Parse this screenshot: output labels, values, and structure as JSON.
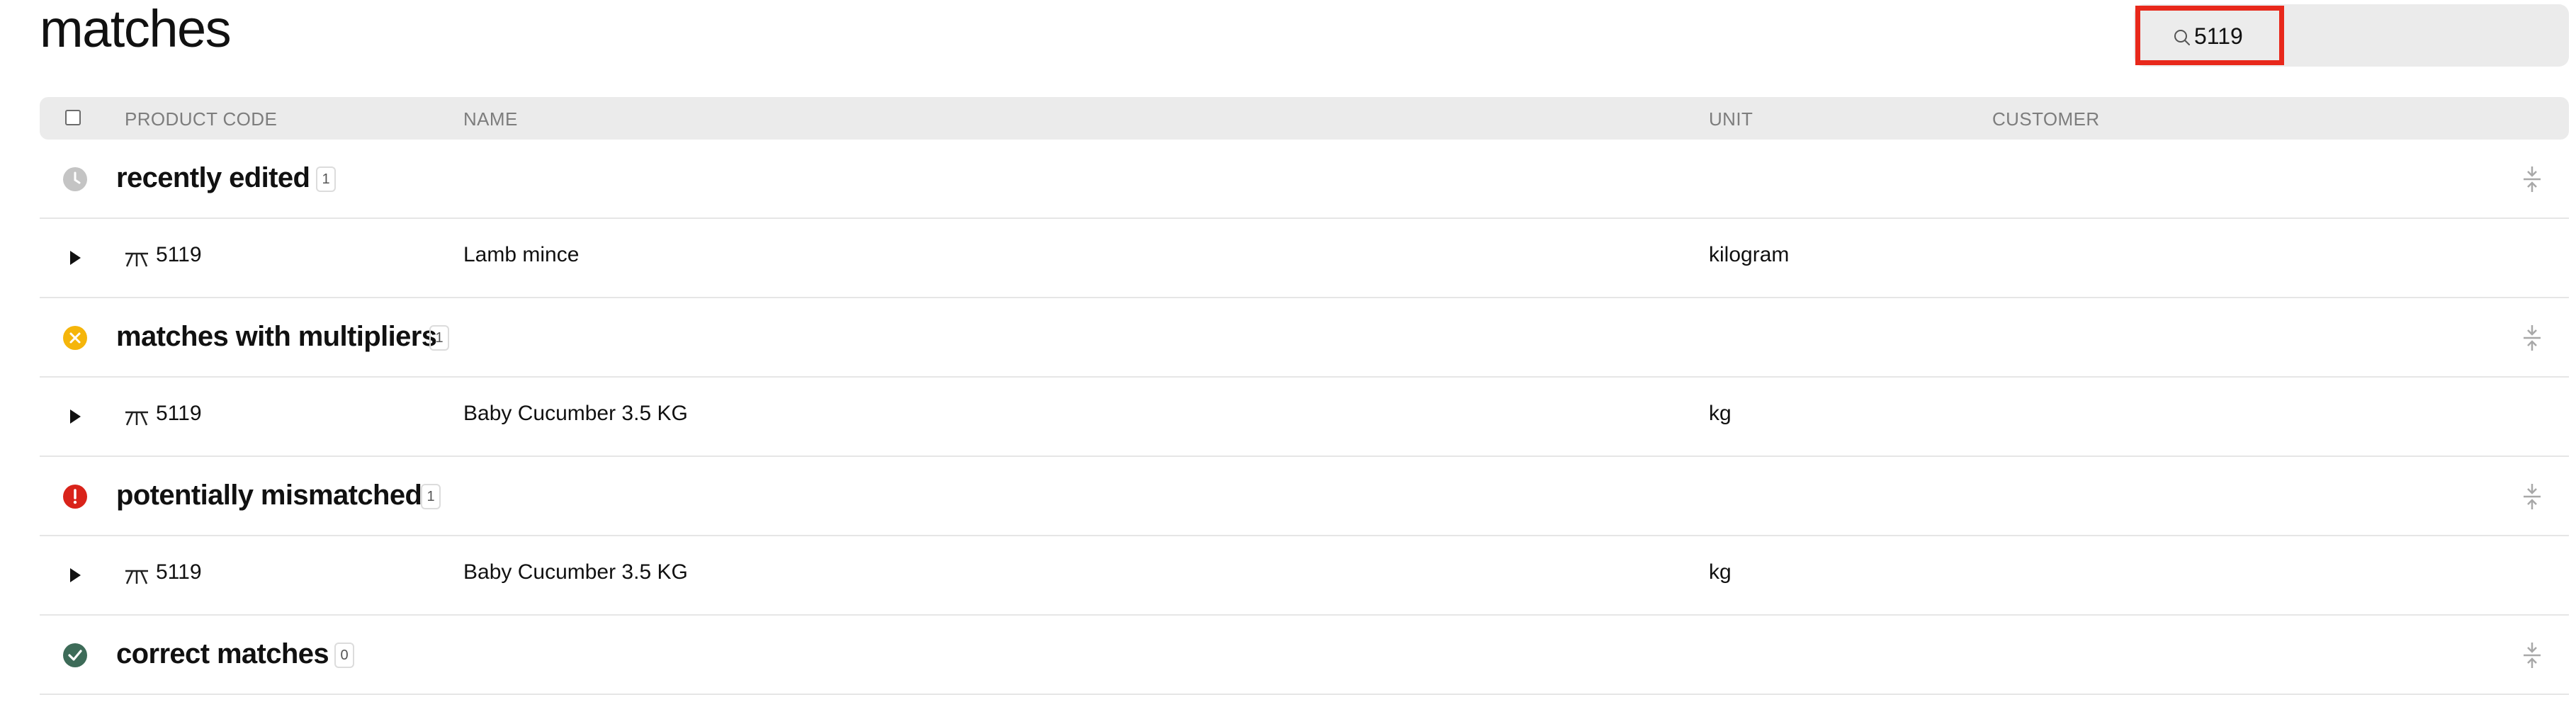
{
  "page": {
    "title": "matches"
  },
  "search": {
    "value": "5119",
    "placeholder": ""
  },
  "table": {
    "columns": {
      "product_code": "PRODUCT CODE",
      "name": "NAME",
      "unit": "UNIT",
      "customer": "CUSTOMER"
    }
  },
  "groups": [
    {
      "label": "recently edited",
      "count": "1",
      "icon": "clock-icon",
      "color": "#c4c4c4",
      "items": [
        {
          "code": "5119",
          "name": "Lamb mince",
          "unit": "kilogram",
          "customer": ""
        }
      ]
    },
    {
      "label": "matches with multipliers",
      "count": "1",
      "icon": "multiplier-icon",
      "color": "#f5b50a",
      "items": [
        {
          "code": "5119",
          "name": "Baby Cucumber 3.5 KG",
          "unit": "kg",
          "customer": ""
        }
      ]
    },
    {
      "label": "potentially mismatched",
      "count": "1",
      "icon": "alert-icon",
      "color": "#d9231a",
      "items": [
        {
          "code": "5119",
          "name": "Baby Cucumber 3.5 KG",
          "unit": "kg",
          "customer": ""
        }
      ]
    },
    {
      "label": "correct matches",
      "count": "0",
      "icon": "check-icon",
      "color": "#3d6b58",
      "items": []
    }
  ]
}
